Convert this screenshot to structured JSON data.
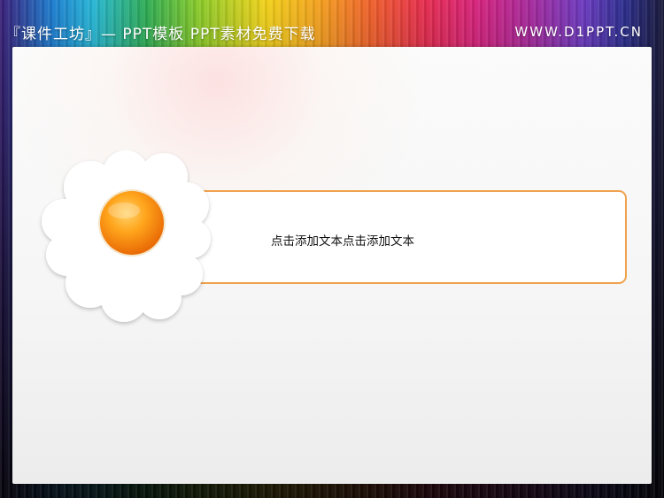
{
  "header": {
    "left_title": "『课件工坊』— PPT模板 PPT素材免费下载",
    "right_url": "WWW.D1PPT.CN"
  },
  "slide": {
    "body_text": "点击添加文本点击添加文本"
  },
  "colors": {
    "accent_orange": "#f0a24e",
    "dot_orange": "#f78a10",
    "flower": "#ffffff"
  },
  "icons": {
    "flower": "flower-icon",
    "dot": "orange-dot-icon"
  }
}
